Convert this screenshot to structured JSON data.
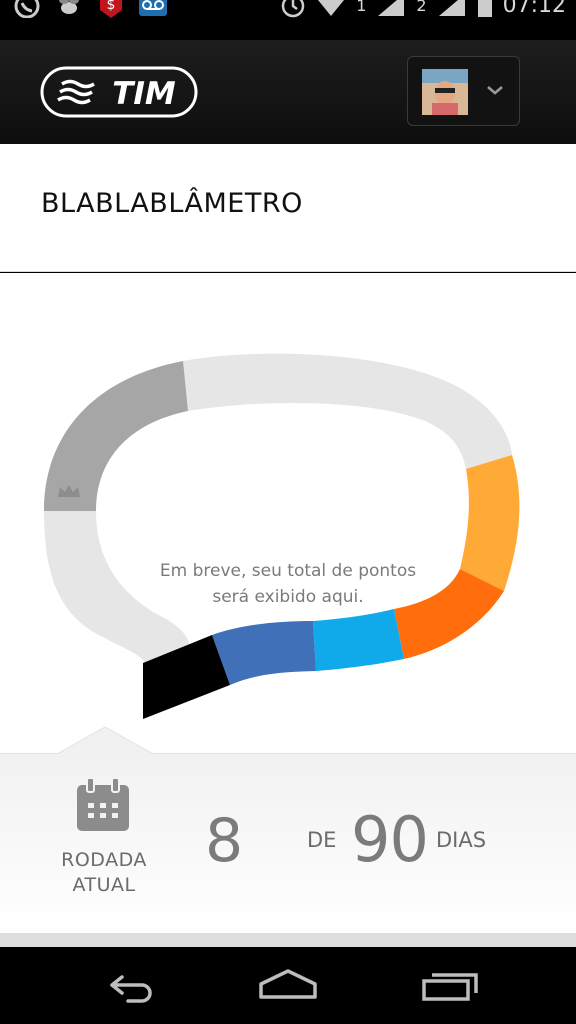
{
  "status_bar": {
    "signal_1": "1",
    "signal_2": "2",
    "time": "07:12",
    "icons": [
      "whatsapp-icon",
      "bee-icon",
      "money-bag-icon",
      "voicemail-icon",
      "alarm-icon",
      "wifi-icon",
      "signal-icon",
      "battery-icon"
    ]
  },
  "header": {
    "logo_text": "TIM",
    "account_menu_icon": "chevron-down-icon"
  },
  "page": {
    "title": "BLABLABLÂMETRO"
  },
  "meter": {
    "message_line1": "Em breve, seu total de pontos",
    "message_line2": "será exibido aqui.",
    "colors": {
      "track": "#e6e6e6",
      "dark_gray": "#a6a6a6",
      "yellow_orange": "#ffaa36",
      "orange": "#ff6d0c",
      "light_blue": "#10aaea",
      "blue": "#3f70b8",
      "black": "#000000"
    },
    "crown_icon": "crown-icon"
  },
  "round": {
    "label_line1": "RODADA",
    "label_line2": "ATUAL",
    "current_day": "8",
    "of_label": "DE",
    "total_days": "90",
    "days_label": "DIAS",
    "icon": "calendar-icon"
  },
  "nav": {
    "back_icon": "back-icon",
    "home_icon": "home-icon",
    "recents_icon": "recent-apps-icon"
  }
}
